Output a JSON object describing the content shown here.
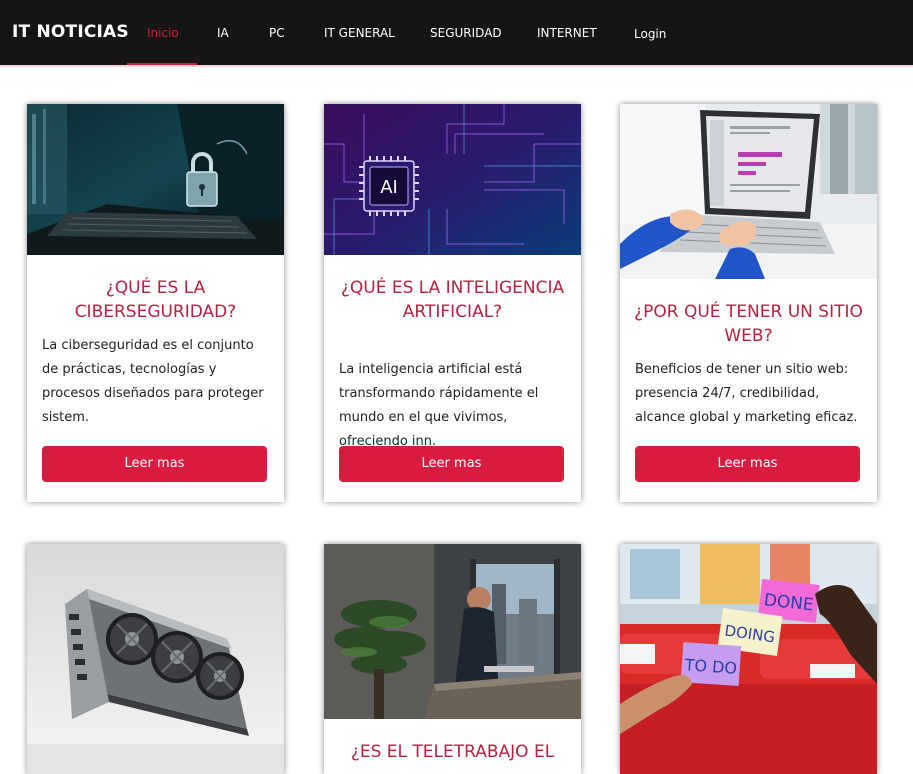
{
  "nav": {
    "brand": "IT NOTICIAS",
    "items": [
      {
        "label": "Inicio",
        "active": true
      },
      {
        "label": "IA"
      },
      {
        "label": "PC"
      },
      {
        "label": "IT GENERAL"
      },
      {
        "label": "SEGURIDAD"
      },
      {
        "label": "INTERNET"
      },
      {
        "label": "Login"
      }
    ]
  },
  "cards": [
    {
      "title": "¿QUÉ ES LA CIBERSEGURIDAD?",
      "text": "La ciberseguridad es el conjunto de prácticas, tecnologías y procesos diseñados para proteger sistem.",
      "button": "Leer mas",
      "image_icon": "padlock-laptop-image"
    },
    {
      "title": "¿QUÉ ES LA INTELIGENCIA ARTIFICIAL?",
      "text": "La inteligencia artificial está transformando rápidamente el mundo en el que vivimos, ofreciendo inn.",
      "button": "Leer mas",
      "image_icon": "ai-chip-image",
      "image_label": "AI"
    },
    {
      "title": "¿POR QUÉ TENER UN SITIO WEB?",
      "text": "Beneficios de tener un sitio web: presencia 24/7, credibilidad, alcance global y marketing eficaz.",
      "button": "Leer mas",
      "image_icon": "laptop-typing-image"
    },
    {
      "title": "",
      "text": "",
      "image_icon": "graphics-card-image"
    },
    {
      "title": "¿ES EL TELETRABAJO EL",
      "text": "",
      "image_icon": "remote-work-image"
    },
    {
      "title": "",
      "text": "",
      "image_icon": "sticky-notes-image",
      "notes": [
        "DONE",
        "DOING",
        "TO DO"
      ]
    }
  ],
  "colors": {
    "accent": "#d81b3f",
    "title": "#b9223e",
    "navbar": "#151515"
  }
}
